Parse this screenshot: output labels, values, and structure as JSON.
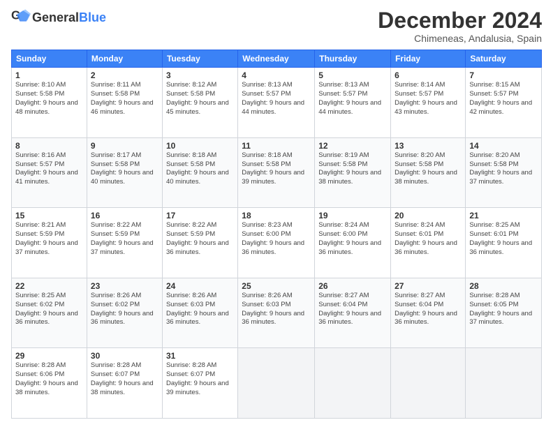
{
  "logo": {
    "text_general": "General",
    "text_blue": "Blue"
  },
  "header": {
    "month_title": "December 2024",
    "location": "Chimeneas, Andalusia, Spain"
  },
  "weekdays": [
    "Sunday",
    "Monday",
    "Tuesday",
    "Wednesday",
    "Thursday",
    "Friday",
    "Saturday"
  ],
  "weeks": [
    [
      {
        "day": "1",
        "sunrise": "8:10 AM",
        "sunset": "5:58 PM",
        "daylight": "9 hours and 48 minutes."
      },
      {
        "day": "2",
        "sunrise": "8:11 AM",
        "sunset": "5:58 PM",
        "daylight": "9 hours and 46 minutes."
      },
      {
        "day": "3",
        "sunrise": "8:12 AM",
        "sunset": "5:58 PM",
        "daylight": "9 hours and 45 minutes."
      },
      {
        "day": "4",
        "sunrise": "8:13 AM",
        "sunset": "5:57 PM",
        "daylight": "9 hours and 44 minutes."
      },
      {
        "day": "5",
        "sunrise": "8:13 AM",
        "sunset": "5:57 PM",
        "daylight": "9 hours and 44 minutes."
      },
      {
        "day": "6",
        "sunrise": "8:14 AM",
        "sunset": "5:57 PM",
        "daylight": "9 hours and 43 minutes."
      },
      {
        "day": "7",
        "sunrise": "8:15 AM",
        "sunset": "5:57 PM",
        "daylight": "9 hours and 42 minutes."
      }
    ],
    [
      {
        "day": "8",
        "sunrise": "8:16 AM",
        "sunset": "5:57 PM",
        "daylight": "9 hours and 41 minutes."
      },
      {
        "day": "9",
        "sunrise": "8:17 AM",
        "sunset": "5:58 PM",
        "daylight": "9 hours and 40 minutes."
      },
      {
        "day": "10",
        "sunrise": "8:18 AM",
        "sunset": "5:58 PM",
        "daylight": "9 hours and 40 minutes."
      },
      {
        "day": "11",
        "sunrise": "8:18 AM",
        "sunset": "5:58 PM",
        "daylight": "9 hours and 39 minutes."
      },
      {
        "day": "12",
        "sunrise": "8:19 AM",
        "sunset": "5:58 PM",
        "daylight": "9 hours and 38 minutes."
      },
      {
        "day": "13",
        "sunrise": "8:20 AM",
        "sunset": "5:58 PM",
        "daylight": "9 hours and 38 minutes."
      },
      {
        "day": "14",
        "sunrise": "8:20 AM",
        "sunset": "5:58 PM",
        "daylight": "9 hours and 37 minutes."
      }
    ],
    [
      {
        "day": "15",
        "sunrise": "8:21 AM",
        "sunset": "5:59 PM",
        "daylight": "9 hours and 37 minutes."
      },
      {
        "day": "16",
        "sunrise": "8:22 AM",
        "sunset": "5:59 PM",
        "daylight": "9 hours and 37 minutes."
      },
      {
        "day": "17",
        "sunrise": "8:22 AM",
        "sunset": "5:59 PM",
        "daylight": "9 hours and 36 minutes."
      },
      {
        "day": "18",
        "sunrise": "8:23 AM",
        "sunset": "6:00 PM",
        "daylight": "9 hours and 36 minutes."
      },
      {
        "day": "19",
        "sunrise": "8:24 AM",
        "sunset": "6:00 PM",
        "daylight": "9 hours and 36 minutes."
      },
      {
        "day": "20",
        "sunrise": "8:24 AM",
        "sunset": "6:01 PM",
        "daylight": "9 hours and 36 minutes."
      },
      {
        "day": "21",
        "sunrise": "8:25 AM",
        "sunset": "6:01 PM",
        "daylight": "9 hours and 36 minutes."
      }
    ],
    [
      {
        "day": "22",
        "sunrise": "8:25 AM",
        "sunset": "6:02 PM",
        "daylight": "9 hours and 36 minutes."
      },
      {
        "day": "23",
        "sunrise": "8:26 AM",
        "sunset": "6:02 PM",
        "daylight": "9 hours and 36 minutes."
      },
      {
        "day": "24",
        "sunrise": "8:26 AM",
        "sunset": "6:03 PM",
        "daylight": "9 hours and 36 minutes."
      },
      {
        "day": "25",
        "sunrise": "8:26 AM",
        "sunset": "6:03 PM",
        "daylight": "9 hours and 36 minutes."
      },
      {
        "day": "26",
        "sunrise": "8:27 AM",
        "sunset": "6:04 PM",
        "daylight": "9 hours and 36 minutes."
      },
      {
        "day": "27",
        "sunrise": "8:27 AM",
        "sunset": "6:04 PM",
        "daylight": "9 hours and 36 minutes."
      },
      {
        "day": "28",
        "sunrise": "8:28 AM",
        "sunset": "6:05 PM",
        "daylight": "9 hours and 37 minutes."
      }
    ],
    [
      {
        "day": "29",
        "sunrise": "8:28 AM",
        "sunset": "6:06 PM",
        "daylight": "9 hours and 38 minutes."
      },
      {
        "day": "30",
        "sunrise": "8:28 AM",
        "sunset": "6:07 PM",
        "daylight": "9 hours and 38 minutes."
      },
      {
        "day": "31",
        "sunrise": "8:28 AM",
        "sunset": "6:07 PM",
        "daylight": "9 hours and 39 minutes."
      },
      null,
      null,
      null,
      null
    ]
  ],
  "labels": {
    "sunrise": "Sunrise:",
    "sunset": "Sunset:",
    "daylight": "Daylight:"
  }
}
